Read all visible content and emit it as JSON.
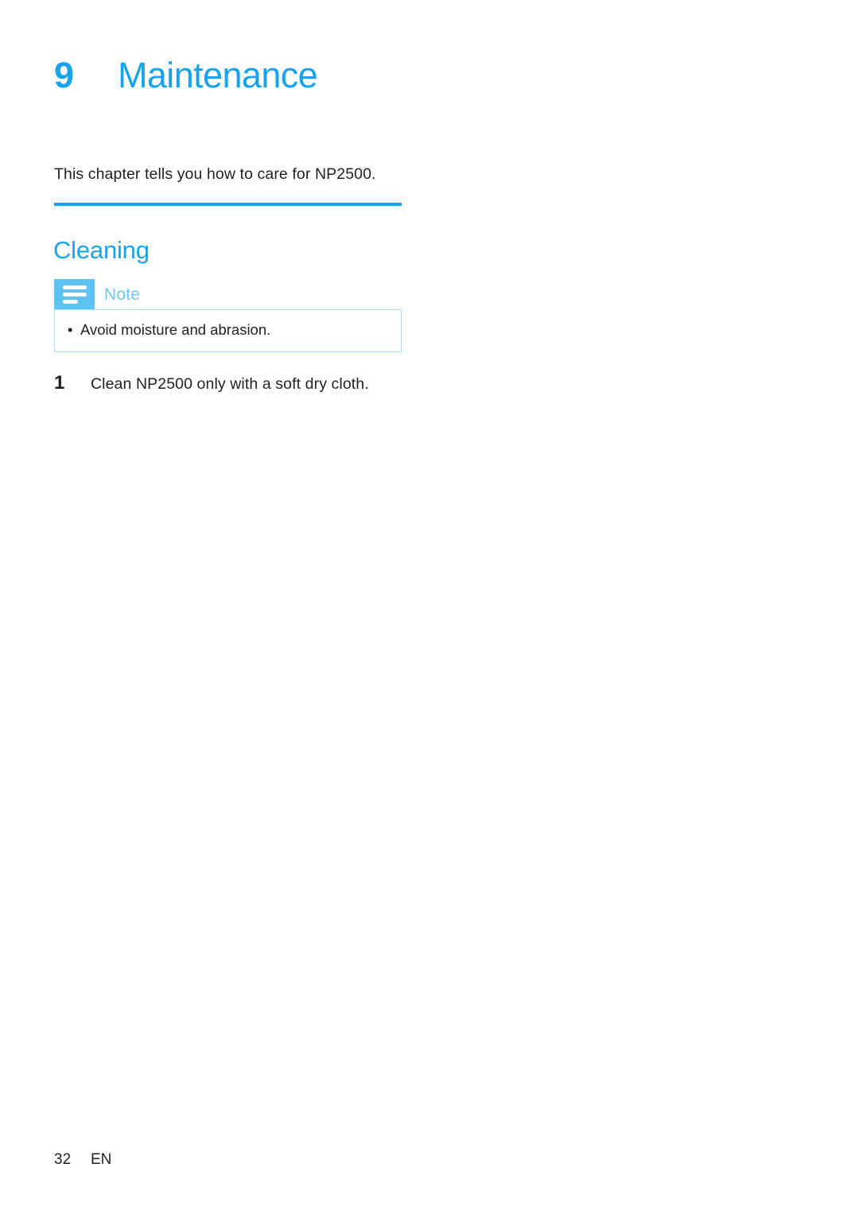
{
  "document": {
    "chapter": {
      "number": "9",
      "title": "Maintenance"
    },
    "intro": "This chapter tells you how to care for NP2500.",
    "section": {
      "title": "Cleaning"
    },
    "note": {
      "label": "Note",
      "icon": "note-lines-icon",
      "bullet_glyph": "•",
      "items": [
        "Avoid moisture and abrasion."
      ]
    },
    "steps": [
      {
        "number": "1",
        "text": "Clean NP2500 only with a soft dry cloth."
      }
    ],
    "footer": {
      "page_number": "32",
      "language": "EN"
    },
    "colors": {
      "accent_blue": "#19A3EC",
      "note_icon_blue": "#5EC3F2",
      "note_label_blue": "#6FC7F2",
      "note_border_blue": "#A9E0F9",
      "body_text": "#231f20",
      "page_background": "#ffffff"
    }
  }
}
